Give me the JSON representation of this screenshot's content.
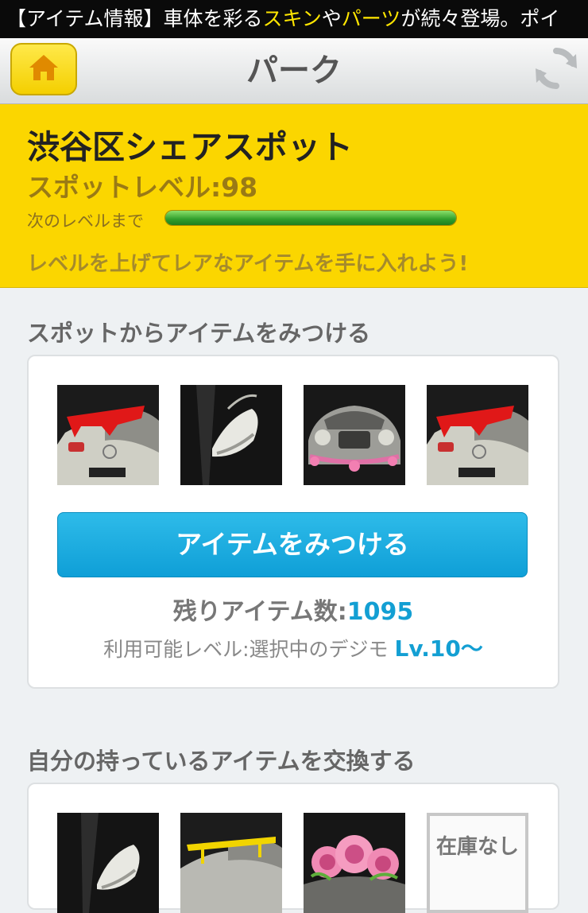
{
  "ticker": {
    "part1": "【アイテム情報】車体を彩る",
    "hl1": "スキン",
    "part2": "や",
    "hl2": "パーツ",
    "part3": "が続々登場。ポイ"
  },
  "navbar": {
    "title": "パーク",
    "home_icon": "home-icon",
    "refresh_icon": "refresh-icon"
  },
  "spot": {
    "name": "渋谷区シェアスポット",
    "level_text": "スポットレベル:98",
    "next_label": "次のレベルまで",
    "progress": 1.0,
    "message": "レベルを上げてレアなアイテムを手に入れよう!"
  },
  "find_section": {
    "title": "スポットからアイテムをみつける",
    "thumbnails": [
      "red-spoiler-car",
      "white-side-mirror",
      "classic-car-pink-ornament",
      "red-spoiler-car"
    ],
    "button_label": "アイテムをみつける",
    "remaining_label": "残りアイテム数:",
    "remaining_count": "1095",
    "available_label": "利用可能レベル:選択中のデジモ",
    "available_level": "Lv.10〜"
  },
  "exchange_section": {
    "title": "自分の持っているアイテムを交換する",
    "thumbnails": [
      "white-side-mirror",
      "yellow-spoiler-car",
      "pink-roses"
    ],
    "out_of_stock_label": "在庫なし"
  },
  "colors": {
    "accent_yellow": "#fbd600",
    "button_blue": "#139fd3",
    "progress_green": "#2f9e2c"
  }
}
